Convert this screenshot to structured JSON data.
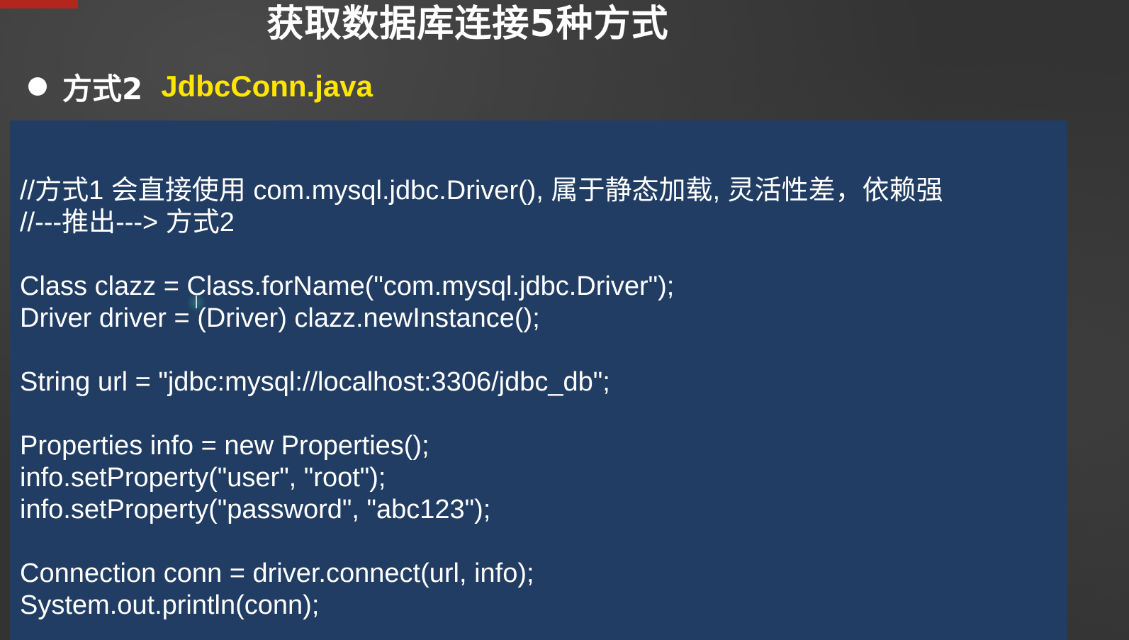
{
  "slide": {
    "title": "获取数据库连接5种方式",
    "bullet": {
      "label": "方式2",
      "filename": "JdbcConn.java"
    }
  },
  "code": {
    "lines": [
      "//方式1 会直接使用 com.mysql.jdbc.Driver(), 属于静态加载, 灵活性差，依赖强",
      "//---推出---> 方式2",
      "",
      "Class clazz = Class.forName(\"com.mysql.jdbc.Driver\");",
      "Driver driver = (Driver) clazz.newInstance();",
      "",
      "String url = \"jdbc:mysql://localhost:3306/jdbc_db\";",
      "",
      "Properties info = new Properties();",
      "info.setProperty(\"user\", \"root\");",
      "info.setProperty(\"password\", \"abc123\");",
      "",
      "Connection conn = driver.connect(url, info);",
      "System.out.println(conn);"
    ]
  },
  "colors": {
    "background": "#333333",
    "code_panel": "#213d63",
    "filename_accent": "#ffe600",
    "corner_mark": "#b3261e"
  }
}
